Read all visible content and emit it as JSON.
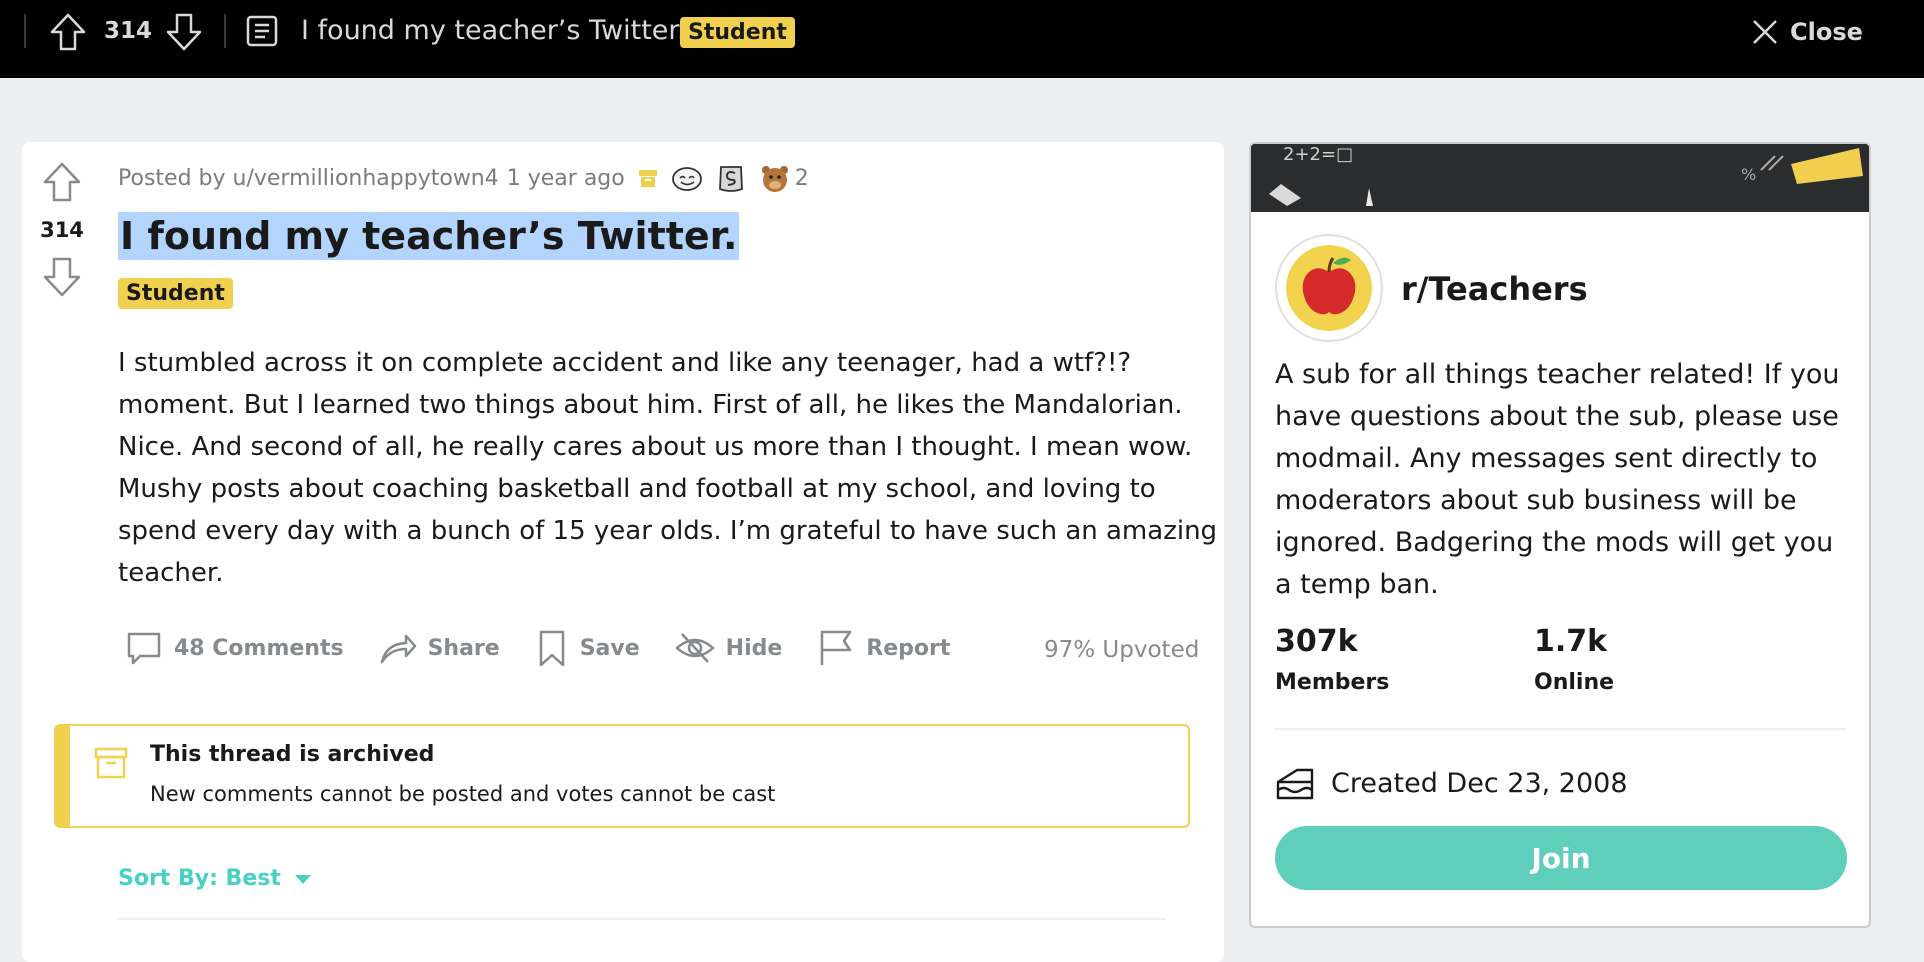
{
  "topbar": {
    "score": "314",
    "title": "I found my teacher’s Twitter.",
    "flair": "Student",
    "close_label": "Close"
  },
  "post": {
    "score": "314",
    "meta": {
      "author": "Posted by u/vermillionhappytown4",
      "time": "1 year ago",
      "award_count": "2",
      "icons": [
        "archive-icon",
        "award-smile-icon",
        "award-silver-icon",
        "award-bear-icon"
      ]
    },
    "title": "I found my teacher’s Twitter.",
    "flair": "Student",
    "body": "I stumbled across it on complete accident and like any teenager, had a wtf?!? moment. But I learned two things about him. First of all, he likes the Mandalorian. Nice. And second of all, he really cares about us more than I thought. I mean wow. Mushy posts about coaching basketball and football at my school, and loving to spend every day with a bunch of 15 year olds. I’m grateful to have such an amazing teacher.",
    "actions": {
      "comments": "48 Comments",
      "share": "Share",
      "save": "Save",
      "hide": "Hide",
      "report": "Report"
    },
    "upvoted": "97% Upvoted"
  },
  "archived": {
    "title": "This thread is archived",
    "text": "New comments cannot be posted and votes cannot be cast"
  },
  "sort": {
    "label": "Sort By: Best"
  },
  "sidebar": {
    "name": "r/Teachers",
    "description": "A sub for all things teacher related! If you have questions about the sub, please use modmail. Any messages sent directly to moderators about sub business will be ignored. Badgering the mods will get you a temp ban.",
    "members_value": "307k",
    "members_label": "Members",
    "online_value": "1.7k",
    "online_label": "Online",
    "created": "Created Dec 23, 2008",
    "join_label": "Join",
    "banner_text": "2+2=□"
  },
  "colors": {
    "flair": "#f2d04f",
    "join": "#5fcfbb",
    "sort": "#46d1c2",
    "selection": "#b3d4fc"
  }
}
